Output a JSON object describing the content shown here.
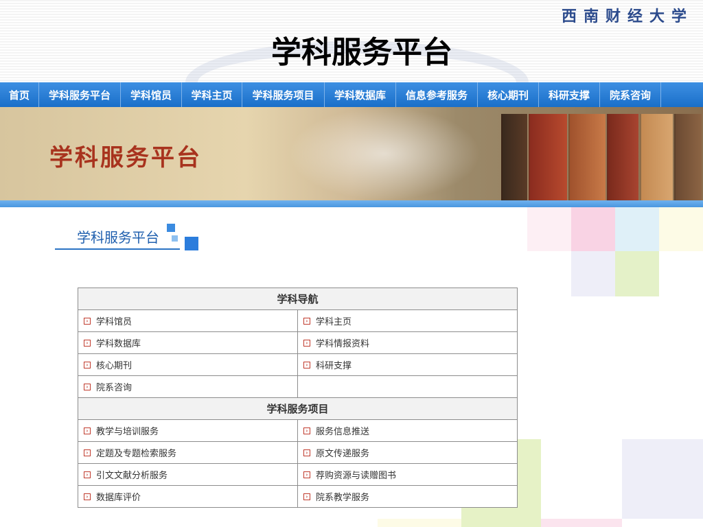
{
  "header": {
    "university_name": "西南财经大学",
    "slide_title": "学科服务平台"
  },
  "nav": {
    "items": [
      {
        "label": "首页"
      },
      {
        "label": "学科服务平台"
      },
      {
        "label": "学科馆员"
      },
      {
        "label": "学科主页"
      },
      {
        "label": "学科服务项目"
      },
      {
        "label": "学科数据库"
      },
      {
        "label": "信息参考服务"
      },
      {
        "label": "核心期刊"
      },
      {
        "label": "科研支撑"
      },
      {
        "label": "院系咨询"
      }
    ]
  },
  "banner": {
    "title": "学科服务平台"
  },
  "section": {
    "heading": "学科服务平台"
  },
  "table": {
    "nav_header": "学科导航",
    "nav_rows": [
      [
        "学科馆员",
        "学科主页"
      ],
      [
        "学科数据库",
        "学科情报资料"
      ],
      [
        "核心期刊",
        "科研支撑"
      ],
      [
        "院系咨询",
        ""
      ]
    ],
    "service_header": "学科服务项目",
    "service_rows": [
      [
        "教学与培训服务",
        "服务信息推送"
      ],
      [
        "定题及专题检索服务",
        "原文传递服务"
      ],
      [
        "引文文献分析服务",
        "荐购资源与读赠图书"
      ],
      [
        "数据库评价",
        "院系教学服务"
      ]
    ]
  },
  "colors": {
    "nav_bg": "#1a6fc9",
    "accent_blue": "#2a73c4",
    "banner_title": "#a8331e",
    "bullet_red": "#c0392b"
  },
  "icons": {
    "bullet": "arrow-box-icon"
  }
}
